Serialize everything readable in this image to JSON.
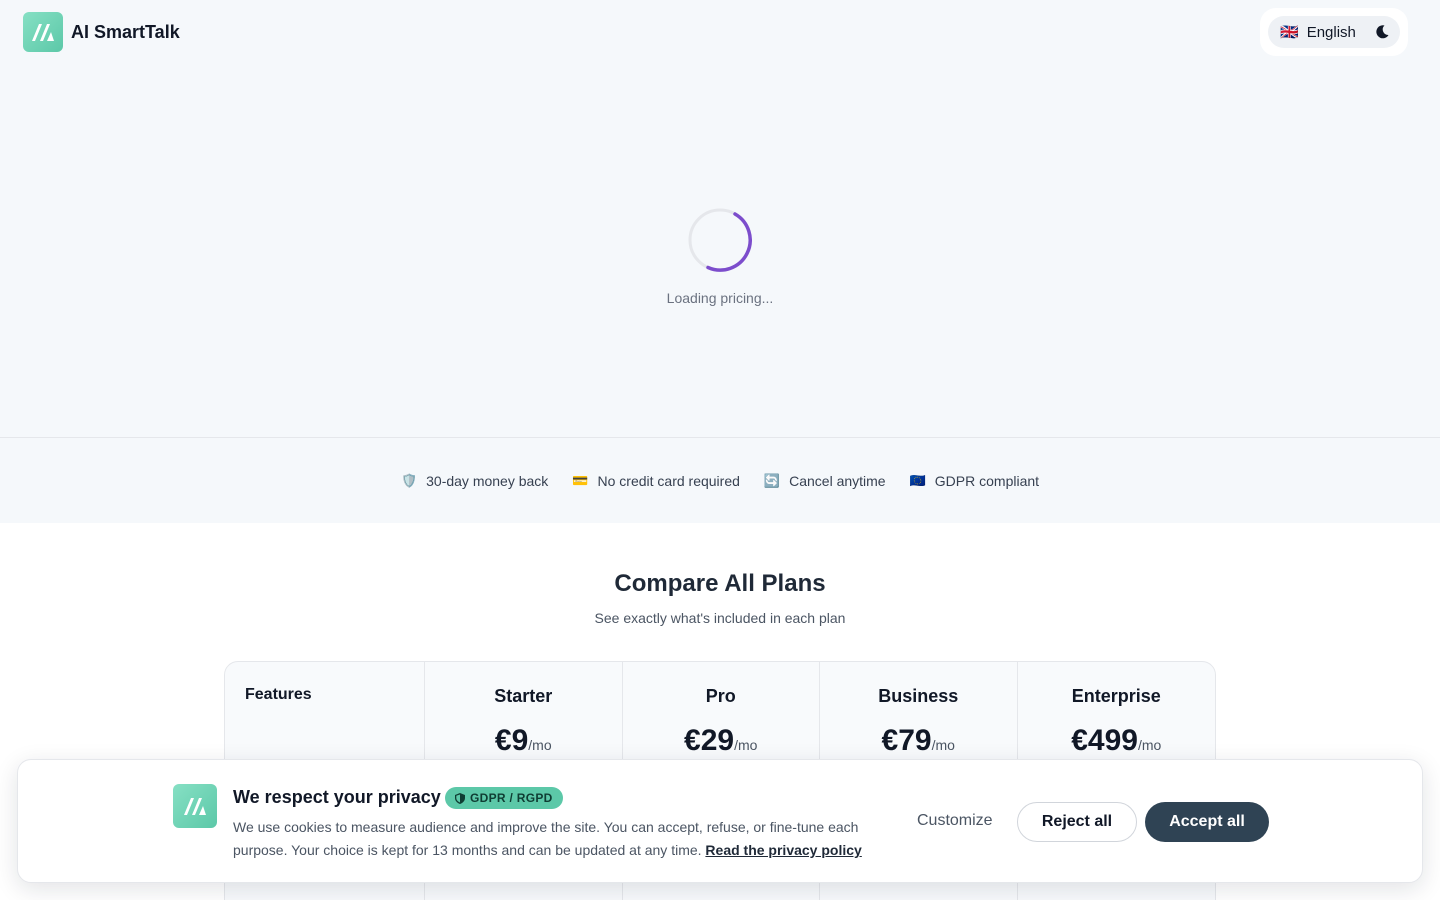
{
  "header": {
    "brand_name": "AI SmartTalk",
    "language": {
      "flag": "🇬🇧",
      "label": "English"
    },
    "theme_toggle_icon": "moon-icon"
  },
  "loading": {
    "text": "Loading pricing..."
  },
  "trust": [
    {
      "icon": "🛡️",
      "label": "30-day money back"
    },
    {
      "icon": "💳",
      "label": "No credit card required"
    },
    {
      "icon": "🔄",
      "label": "Cancel anytime"
    },
    {
      "icon": "🇪🇺",
      "label": "GDPR compliant"
    }
  ],
  "compare": {
    "title": "Compare All Plans",
    "subtitle": "See exactly what's included in each plan",
    "features_label": "Features",
    "plans": [
      {
        "name": "Starter",
        "price": "€9",
        "period": "/mo"
      },
      {
        "name": "Pro",
        "price": "€29",
        "period": "/mo"
      },
      {
        "name": "Business",
        "price": "€79",
        "period": "/mo"
      },
      {
        "name": "Enterprise",
        "price": "€499",
        "period": "/mo"
      }
    ]
  },
  "cookie": {
    "title": "We respect your privacy",
    "badge": "GDPR / RGPD",
    "text": "We use cookies to measure audience and improve the site. You can accept, refuse, or fine-tune each purpose. Your choice is kept for 13 months and can be updated at any time.",
    "link": "Read the privacy policy",
    "customize_label": "Customize",
    "reject_label": "Reject all",
    "accept_label": "Accept all"
  },
  "colors": {
    "brand": "#5cc8a8",
    "spinner": "#7c4dcc",
    "accept_button": "#2f4354"
  }
}
